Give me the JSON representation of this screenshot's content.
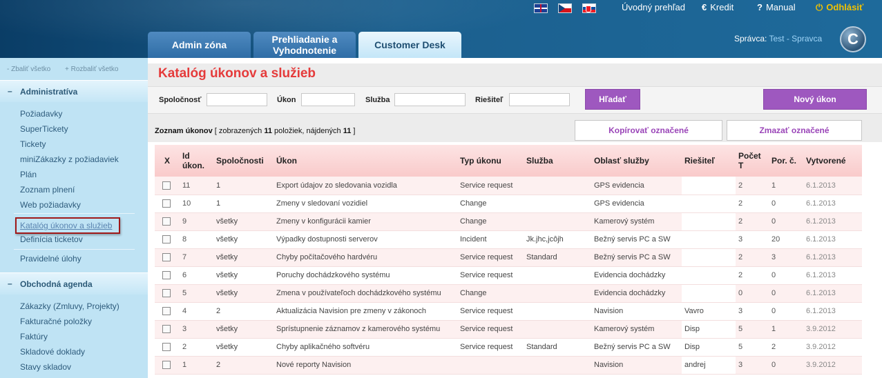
{
  "topnav": {
    "overview": "Úvodný prehľad",
    "credit": "Kredit",
    "manual": "Manual",
    "logout": "Odhlásiť",
    "credit_icon": "€",
    "manual_icon": "?",
    "logout_icon": "⏻"
  },
  "tabs": [
    "Admin zóna",
    "Prehliadanie a Vyhodnotenie",
    "Customer Desk"
  ],
  "user": {
    "label": "Správca:",
    "name": "Test - Spravca"
  },
  "logo_letter": "C",
  "sidebar": {
    "collapse_all": "- Zbaliť všetko",
    "expand_all": "+ Rozbaliť všetko",
    "section_admin": "Administratíva",
    "admin_items": [
      "Požiadavky",
      "SuperTickety",
      "Tickety",
      "miniZákazky z požiadaviek",
      "Plán",
      "Zoznam plnení",
      "Web požiadavky",
      "Katalóg úkonov a služieb",
      "Definícia ticketov",
      "Pravidelné úlohy"
    ],
    "section_business": "Obchodná agenda",
    "business_items": [
      "Zákazky (Zmluvy, Projekty)",
      "Fakturačné položky",
      "Faktúry",
      "Skladové doklady",
      "Stavy skladov"
    ]
  },
  "page": {
    "title": "Katalóg úkonov a služieb",
    "filters": {
      "company": "Spoločnosť",
      "action": "Úkon",
      "service": "Služba",
      "solver": "Riešiteľ"
    },
    "search_button": "Hľadať",
    "new_button": "Nový úkon",
    "copy_button": "Kopírovať označené",
    "delete_button": "Zmazať označené",
    "summary": {
      "prefix": "Zoznam úkonov",
      "a": " [ zobrazených ",
      "shown": "11",
      "b": " položiek, nájdených ",
      "found": "11",
      "c": " ]"
    }
  },
  "table": {
    "headers": [
      "X",
      "Id úkon.",
      "Spoločnosti",
      "Úkon",
      "Typ úkonu",
      "Služba",
      "Oblasť služby",
      "Riešiteľ",
      "Počet T",
      "Por. č.",
      "Vytvorené"
    ],
    "rows": [
      [
        "11",
        "1",
        "Export údajov zo sledovania vozidla",
        "Service request",
        "",
        "GPS evidencia",
        "",
        "2",
        "1",
        "6.1.2013"
      ],
      [
        "10",
        "1",
        "Zmeny v sledovaní vozidiel",
        "Change",
        "",
        "GPS evidencia",
        "",
        "2",
        "0",
        "6.1.2013"
      ],
      [
        "9",
        "všetky",
        "Zmeny v konfigurácii kamier",
        "Change",
        "",
        "Kamerový systém",
        "",
        "2",
        "0",
        "6.1.2013"
      ],
      [
        "8",
        "všetky",
        "Výpadky dostupnosti serverov",
        "Incident",
        "Jk.jhc,jcôjh",
        "Bežný servis PC a SW",
        "",
        "3",
        "20",
        "6.1.2013"
      ],
      [
        "7",
        "všetky",
        "Chyby počítačového hardvéru",
        "Service request",
        "Standard",
        "Bežný servis PC a SW",
        "",
        "2",
        "3",
        "6.1.2013"
      ],
      [
        "6",
        "všetky",
        "Poruchy dochádzkového systému",
        "Service request",
        "",
        "Evidencia dochádzky",
        "",
        "2",
        "0",
        "6.1.2013"
      ],
      [
        "5",
        "všetky",
        "Zmena v používateľoch dochádzkového systému",
        "Change",
        "",
        "Evidencia dochádzky",
        "",
        "0",
        "0",
        "6.1.2013"
      ],
      [
        "4",
        "2",
        "Aktualizácia Navision pre zmeny v zákonoch",
        "Service request",
        "",
        "Navision",
        "Vavro",
        "3",
        "0",
        "6.1.2013"
      ],
      [
        "3",
        "všetky",
        "Sprístupnenie záznamov z kamerového systému",
        "Service request",
        "",
        "Kamerový systém",
        "Disp",
        "5",
        "1",
        "3.9.2012"
      ],
      [
        "2",
        "všetky",
        "Chyby aplikačného softvéru",
        "Service request",
        "Standard",
        "Bežný servis PC a SW",
        "Disp",
        "5",
        "2",
        "3.9.2012"
      ],
      [
        "1",
        "2",
        "Nové reporty Navision",
        "",
        "",
        "Navision",
        "andrej",
        "3",
        "0",
        "3.9.2012"
      ]
    ]
  }
}
